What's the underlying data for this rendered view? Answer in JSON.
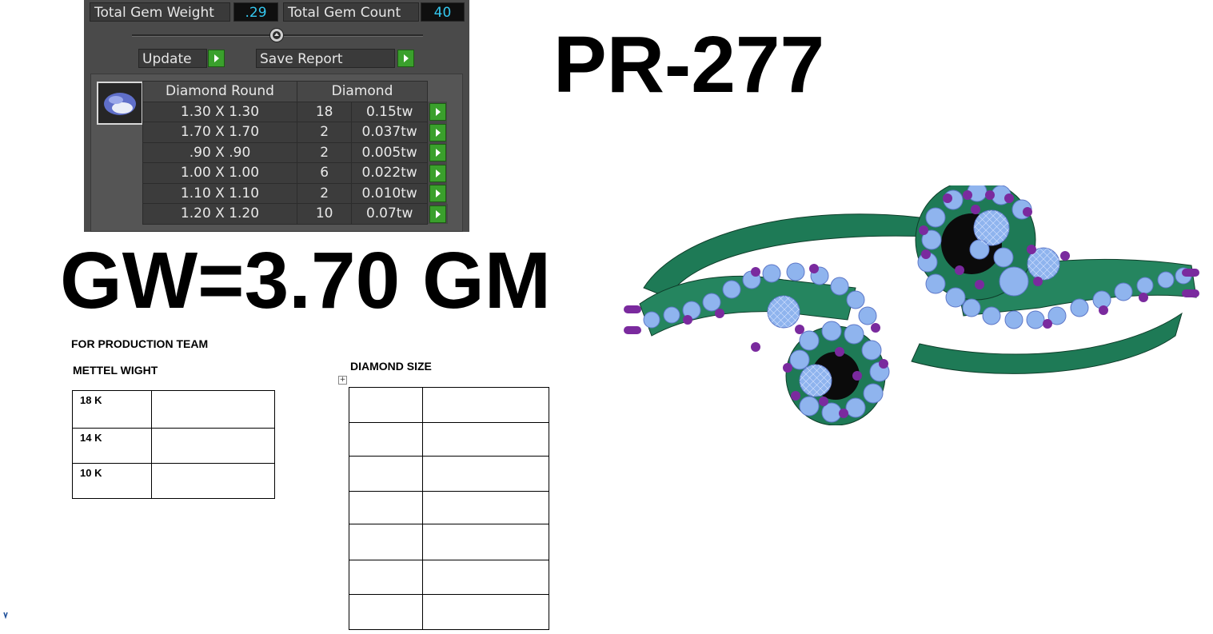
{
  "report_panel": {
    "total_gem_weight_label": "Total Gem Weight",
    "total_gem_weight_value": ".29",
    "total_gem_count_label": "Total Gem Count",
    "total_gem_count_value": "40",
    "update_label": "Update",
    "save_report_label": "Save Report",
    "table": {
      "headers": [
        "Diamond Round",
        "Diamond"
      ],
      "rows": [
        {
          "size": "1.30 X 1.30",
          "count": "18",
          "weight": "0.15tw"
        },
        {
          "size": "1.70 X 1.70",
          "count": "2",
          "weight": "0.037tw"
        },
        {
          "size": ".90 X .90",
          "count": "2",
          "weight": "0.005tw"
        },
        {
          "size": "1.00 X 1.00",
          "count": "6",
          "weight": "0.022tw"
        },
        {
          "size": "1.10 X 1.10",
          "count": "2",
          "weight": "0.010tw"
        },
        {
          "size": "1.20 X 1.20",
          "count": "10",
          "weight": "0.07tw"
        }
      ]
    },
    "colors": {
      "panel": "#4a4a4a",
      "value_text": "#34c8f0",
      "go_button": "#3aa02c"
    }
  },
  "design_code": "PR-277",
  "gross_weight": "GW=3.70 GM",
  "production": {
    "team_heading": "FOR PRODUCTION TEAM",
    "metal_heading": "METTEL WIGHT",
    "metal_rows": [
      "18 K",
      "14 K",
      "10 K"
    ],
    "diamond_heading": "DIAMOND SIZE"
  },
  "ring_render": {
    "icon": "ring-3d-wireframe-icon",
    "colors": {
      "metal": "#1e7a56",
      "stone": "#8fb4ee",
      "prong": "#7a2a9e"
    }
  }
}
